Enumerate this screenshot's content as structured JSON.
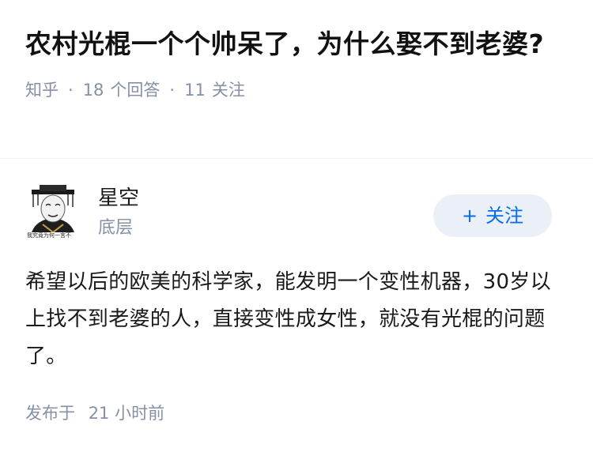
{
  "question": {
    "title": "农村光棍一个个帅呆了，为什么娶不到老婆?",
    "source": "知乎",
    "answers_count": "18",
    "answers_label": "个回答",
    "followers_count": "11",
    "followers_label": "关注"
  },
  "answer": {
    "author": {
      "name": "星空",
      "level": "底层",
      "avatar_icon": "meme-avatar-icon",
      "avatar_caption": "我究竟为何一言不"
    },
    "follow_button": {
      "plus": "+",
      "label": "关注"
    },
    "content": "希望以后的欧美的科学家，能发明一个变性机器，30岁以上找不到老婆的人，直接变性成女性，就没有光棍的问题了。",
    "published_prefix": "发布于",
    "published_time": "21 小时前"
  },
  "colors": {
    "muted_text": "#8590a6",
    "accent": "#056de8",
    "follow_bg": "#ebf0f8",
    "divider": "#f0f0f2"
  }
}
